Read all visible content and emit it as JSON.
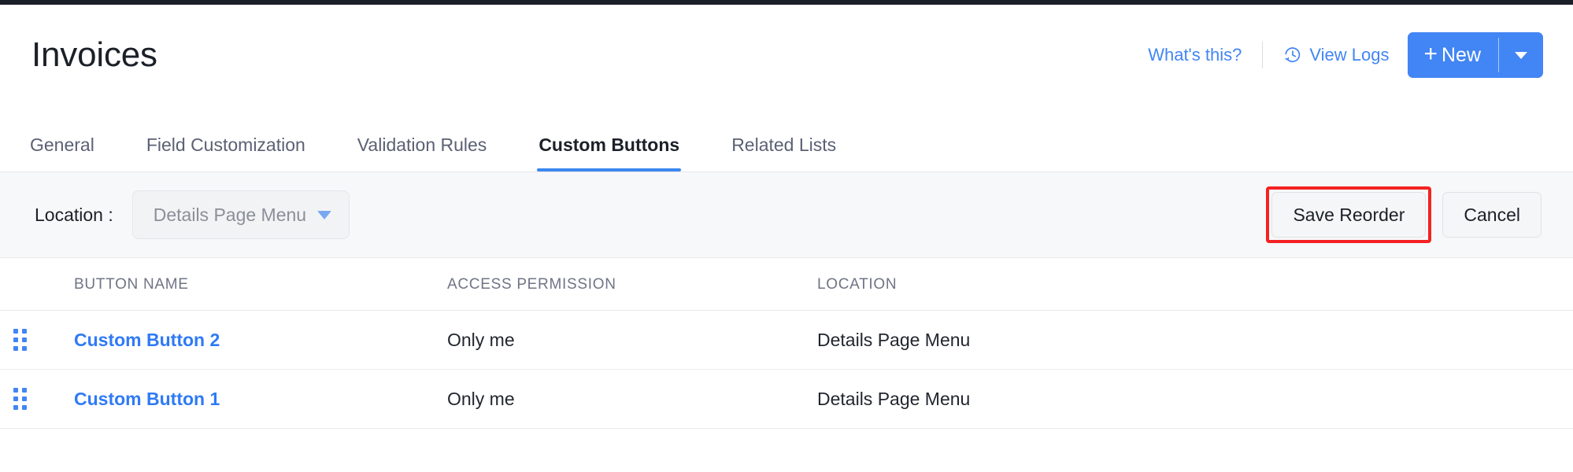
{
  "header": {
    "title": "Invoices",
    "whats_this": "What's this?",
    "view_logs": "View Logs",
    "view_logs_icon": "history-clock-icon",
    "new_button": "New",
    "new_plus": "+",
    "new_dropdown_icon": "chevron-down-icon"
  },
  "tabs": [
    {
      "label": "General",
      "active": false
    },
    {
      "label": "Field Customization",
      "active": false
    },
    {
      "label": "Validation Rules",
      "active": false
    },
    {
      "label": "Custom Buttons",
      "active": true
    },
    {
      "label": "Related Lists",
      "active": false
    }
  ],
  "toolbar": {
    "location_label": "Location :",
    "location_value": "Details Page Menu",
    "location_chevron_icon": "chevron-down-icon",
    "save_reorder": "Save Reorder",
    "cancel": "Cancel",
    "highlight_color": "#f42222",
    "highlighted_button": "Save Reorder"
  },
  "table": {
    "columns": [
      "BUTTON NAME",
      "ACCESS PERMISSION",
      "LOCATION"
    ],
    "rows": [
      {
        "drag_icon": "drag-handle-icon",
        "button_name": "Custom Button 2",
        "access_permission": "Only me",
        "location": "Details Page Menu"
      },
      {
        "drag_icon": "drag-handle-icon",
        "button_name": "Custom Button 1",
        "access_permission": "Only me",
        "location": "Details Page Menu"
      }
    ]
  },
  "colors": {
    "accent_blue": "#4285f4",
    "link_blue": "#2f7af5",
    "tab_underline": "#3c87f0",
    "toolbar_bg": "#f7f8f9",
    "top_strip": "#1b2028"
  }
}
